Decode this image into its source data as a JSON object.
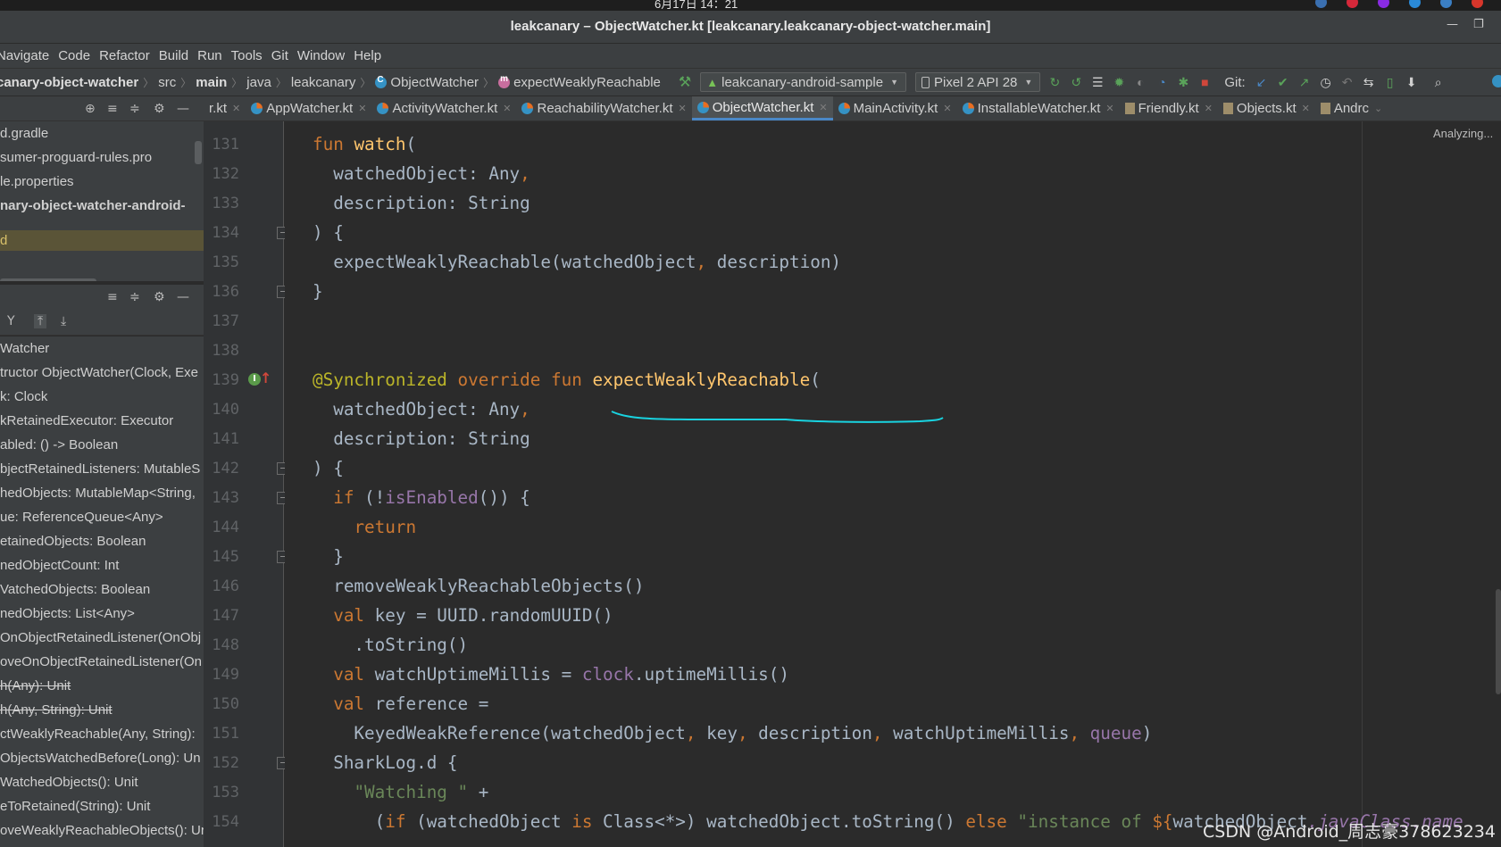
{
  "os": {
    "clock": "6月17日 14：21"
  },
  "window": {
    "title": "leakcanary – ObjectWatcher.kt [leakcanary.leakcanary-object-watcher.main]",
    "min": "—",
    "max": "❐"
  },
  "menu": [
    "Navigate",
    "Code",
    "Refactor",
    "Build",
    "Run",
    "Tools",
    "Git",
    "Window",
    "Help"
  ],
  "breadcrumbs": [
    "canary-object-watcher",
    "src",
    "main",
    "java",
    "leakcanary",
    "ObjectWatcher",
    "expectWeaklyReachable"
  ],
  "run_config": "leakcanary-android-sample",
  "device": "Pixel 2 API 28",
  "git_label": "Git:",
  "tabs": [
    {
      "label": "r.kt",
      "active": false
    },
    {
      "label": "AppWatcher.kt",
      "active": false
    },
    {
      "label": "ActivityWatcher.kt",
      "active": false
    },
    {
      "label": "ReachabilityWatcher.kt",
      "active": false
    },
    {
      "label": "ObjectWatcher.kt",
      "active": true
    },
    {
      "label": "MainActivity.kt",
      "active": false
    },
    {
      "label": "InstallableWatcher.kt",
      "active": false
    },
    {
      "label": "Friendly.kt",
      "active": false
    },
    {
      "label": "Objects.kt",
      "active": false
    },
    {
      "label": "Andrc",
      "active": false
    }
  ],
  "project": {
    "items": [
      "d.gradle",
      "sumer-proguard-rules.pro",
      "le.properties",
      "nary-object-watcher-android-",
      "d"
    ]
  },
  "structure": {
    "items": [
      {
        "label": "Watcher",
        "strike": false
      },
      {
        "label": "tructor ObjectWatcher(Clock, Exe",
        "strike": false
      },
      {
        "label": "k: Clock",
        "strike": false
      },
      {
        "label": "kRetainedExecutor: Executor",
        "strike": false
      },
      {
        "label": "abled: () -> Boolean",
        "strike": false
      },
      {
        "label": "bjectRetainedListeners: MutableS",
        "strike": false
      },
      {
        "label": "hedObjects: MutableMap<String,",
        "strike": false
      },
      {
        "label": "ue: ReferenceQueue<Any>",
        "strike": false
      },
      {
        "label": "etainedObjects: Boolean",
        "strike": false
      },
      {
        "label": "nedObjectCount: Int",
        "strike": false
      },
      {
        "label": "VatchedObjects: Boolean",
        "strike": false
      },
      {
        "label": "nedObjects: List<Any>",
        "strike": false
      },
      {
        "label": "OnObjectRetainedListener(OnObj",
        "strike": false
      },
      {
        "label": "oveOnObjectRetainedListener(On",
        "strike": false
      },
      {
        "label": "h(Any): Unit",
        "strike": true
      },
      {
        "label": "h(Any, String): Unit",
        "strike": true
      },
      {
        "label": "ctWeaklyReachable(Any, String):",
        "strike": false
      },
      {
        "label": "ObjectsWatchedBefore(Long): Un",
        "strike": false
      },
      {
        "label": "WatchedObjects(): Unit",
        "strike": false
      },
      {
        "label": "eToRetained(String): Unit",
        "strike": false
      },
      {
        "label": "oveWeaklyReachableObjects(): Ur",
        "strike": false
      }
    ]
  },
  "code": {
    "lines": [
      {
        "num": "131",
        "tokens": [
          [
            "kw",
            "fun "
          ],
          [
            "fn",
            "watch"
          ],
          [
            "",
            "("
          ]
        ]
      },
      {
        "num": "132",
        "tokens": [
          [
            "",
            "  watchedObject: Any"
          ],
          [
            "comma",
            ","
          ]
        ]
      },
      {
        "num": "133",
        "tokens": [
          [
            "",
            "  description: String"
          ]
        ]
      },
      {
        "num": "134",
        "tokens": [
          [
            "",
            ") {"
          ]
        ]
      },
      {
        "num": "135",
        "tokens": [
          [
            "",
            "  expectWeaklyReachable(watchedObject"
          ],
          [
            "comma",
            ", "
          ],
          [
            "",
            "description)"
          ]
        ]
      },
      {
        "num": "136",
        "tokens": [
          [
            "",
            "}"
          ]
        ]
      },
      {
        "num": "137",
        "tokens": []
      },
      {
        "num": "138",
        "tokens": []
      },
      {
        "num": "139",
        "tokens": [
          [
            "ann",
            "@Synchronized "
          ],
          [
            "kw",
            "override fun "
          ],
          [
            "fn",
            "expectWeaklyReachable"
          ],
          [
            "",
            "("
          ]
        ]
      },
      {
        "num": "140",
        "tokens": [
          [
            "",
            "  watchedObject: Any"
          ],
          [
            "comma",
            ","
          ]
        ]
      },
      {
        "num": "141",
        "tokens": [
          [
            "",
            "  description: String"
          ]
        ]
      },
      {
        "num": "142",
        "tokens": [
          [
            "",
            ") {"
          ]
        ]
      },
      {
        "num": "143",
        "tokens": [
          [
            "",
            "  "
          ],
          [
            "kw",
            "if "
          ],
          [
            "",
            "(!"
          ],
          [
            "prop",
            "isEnabled"
          ],
          [
            "",
            "()) {"
          ]
        ]
      },
      {
        "num": "144",
        "tokens": [
          [
            "",
            "    "
          ],
          [
            "kw",
            "return"
          ]
        ]
      },
      {
        "num": "145",
        "tokens": [
          [
            "",
            "  }"
          ]
        ]
      },
      {
        "num": "146",
        "tokens": [
          [
            "",
            "  removeWeaklyReachableObjects()"
          ]
        ]
      },
      {
        "num": "147",
        "tokens": [
          [
            "",
            "  "
          ],
          [
            "kw",
            "val "
          ],
          [
            "",
            "key = UUID.randomUUID()"
          ]
        ]
      },
      {
        "num": "148",
        "tokens": [
          [
            "",
            "    .toString()"
          ]
        ]
      },
      {
        "num": "149",
        "tokens": [
          [
            "",
            "  "
          ],
          [
            "kw",
            "val "
          ],
          [
            "",
            "watchUptimeMillis = "
          ],
          [
            "prop",
            "clock"
          ],
          [
            "",
            ".uptimeMillis()"
          ]
        ]
      },
      {
        "num": "150",
        "tokens": [
          [
            "",
            "  "
          ],
          [
            "kw",
            "val "
          ],
          [
            "",
            "reference ="
          ]
        ]
      },
      {
        "num": "151",
        "tokens": [
          [
            "",
            "    KeyedWeakReference(watchedObject"
          ],
          [
            "comma",
            ", "
          ],
          [
            "",
            "key"
          ],
          [
            "comma",
            ", "
          ],
          [
            "",
            "description"
          ],
          [
            "comma",
            ", "
          ],
          [
            "",
            "watchUptimeMillis"
          ],
          [
            "comma",
            ", "
          ],
          [
            "prop",
            "queue"
          ],
          [
            "",
            ")"
          ]
        ]
      },
      {
        "num": "152",
        "tokens": [
          [
            "",
            "  SharkLog.d {"
          ]
        ]
      },
      {
        "num": "153",
        "tokens": [
          [
            "",
            "    "
          ],
          [
            "str",
            "\"Watching \" "
          ],
          [
            "",
            "+"
          ]
        ]
      },
      {
        "num": "154",
        "tokens": [
          [
            "",
            "      ("
          ],
          [
            "kw",
            "if "
          ],
          [
            "",
            "(watchedObject "
          ],
          [
            "kw",
            "is "
          ],
          [
            "",
            "Class<*>) watchedObject.toString() "
          ],
          [
            "kw",
            "else "
          ],
          [
            "str",
            "\"instance of "
          ],
          [
            "kw",
            "${"
          ],
          [
            "",
            "watchedObject"
          ],
          [
            "ital",
            ".javaClass.name"
          ]
        ]
      }
    ]
  },
  "status": {
    "analyzing": "Analyzing..."
  },
  "watermark": "CSDN @Android_周志豪378623234",
  "colors": {
    "keyword": "#cc7832",
    "function": "#ffc66d",
    "annotation": "#bbb529",
    "string": "#6a8759",
    "property": "#9876aa",
    "text": "#a9b7c6",
    "accent": "#4a88c7"
  }
}
